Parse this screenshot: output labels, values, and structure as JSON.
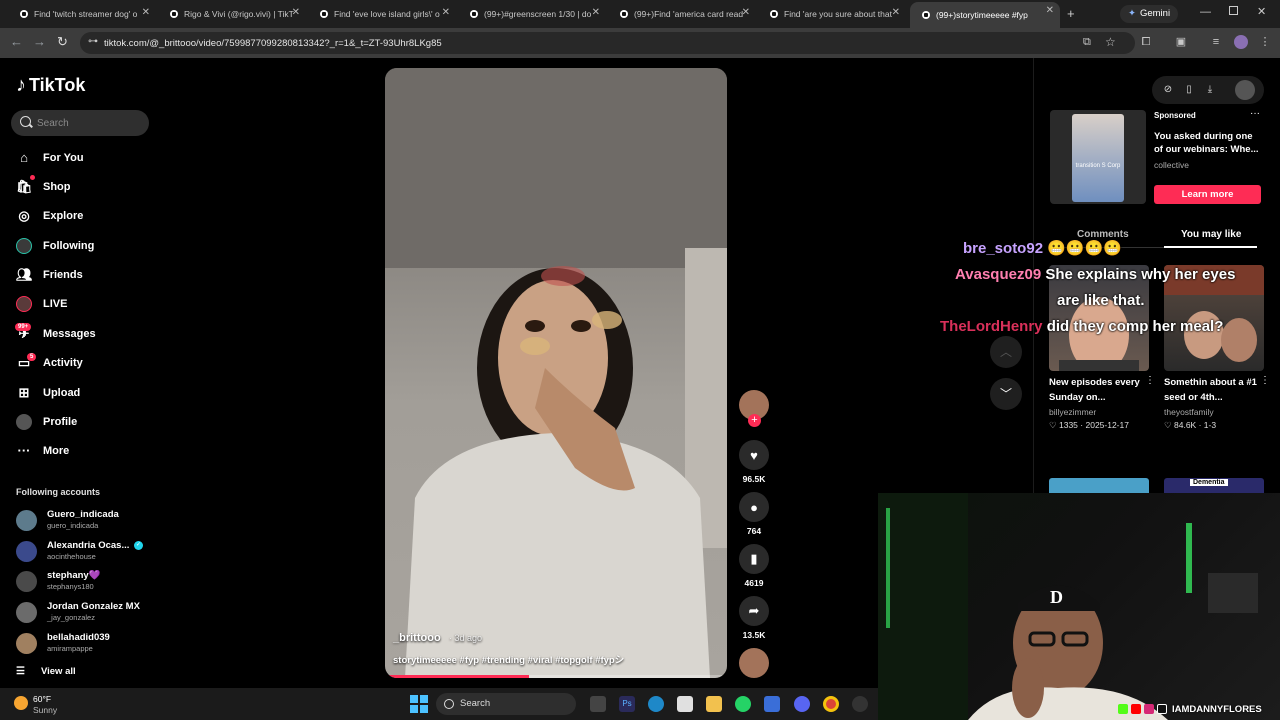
{
  "browser": {
    "tabs": [
      {
        "label": "Find 'twitch streamer dog' o"
      },
      {
        "label": "Rigo & Vivi (@rigo.vivi) | TikT"
      },
      {
        "label": "Find 'eve love island girls\\' o"
      },
      {
        "label": "(99+)#greenscreen 1/30 | do"
      },
      {
        "label": "(99+)Find 'america card read"
      },
      {
        "label": "Find 'are you sure about that"
      },
      {
        "label": "(99+)storytimeeeee #fyp"
      }
    ],
    "new_tab": "+",
    "gemini_label": "Gemini",
    "url": "tiktok.com/@_brittooo/video/7599877099280813342?_r=1&_t=ZT-93Uhr8LKg85"
  },
  "sidebar": {
    "logo": "TikTok",
    "search_placeholder": "Search",
    "items": [
      {
        "label": "For You",
        "icon": "home-icon"
      },
      {
        "label": "Shop",
        "icon": "shop-icon"
      },
      {
        "label": "Explore",
        "icon": "compass-icon"
      },
      {
        "label": "Following",
        "icon": "following-avatar-icon"
      },
      {
        "label": "Friends",
        "icon": "friends-icon"
      },
      {
        "label": "LIVE",
        "icon": "live-icon"
      },
      {
        "label": "Messages",
        "icon": "messages-icon",
        "badge": "99+"
      },
      {
        "label": "Activity",
        "icon": "activity-icon",
        "badge": "5"
      },
      {
        "label": "Upload",
        "icon": "upload-icon"
      },
      {
        "label": "Profile",
        "icon": "profile-icon"
      },
      {
        "label": "More",
        "icon": "more-icon"
      }
    ],
    "following_title": "Following accounts",
    "accounts": [
      {
        "name": "Guero_indicada",
        "handle": "guero_indicada"
      },
      {
        "name": "Alexandria Ocas...",
        "handle": "aocinthehouse"
      },
      {
        "name": "stephany💜",
        "handle": "stephanys180"
      },
      {
        "name": "Jordan Gonzalez MX",
        "handle": "_jay_gonzalez"
      },
      {
        "name": "bellahadid039",
        "handle": "amirampappe"
      }
    ],
    "view_all": "View all"
  },
  "video": {
    "author": "_brittooo",
    "date": "· 3d ago",
    "caption": "storytimeeeee #fyp #trending #viral #topgolf #fypシ",
    "progress": 0.42
  },
  "actions": {
    "likes": "96.5K",
    "comments": "764",
    "saves": "4619",
    "shares": "13.5K"
  },
  "right_panel": {
    "sponsored": "Sponsored",
    "ad_title": "You asked during one of our webinars: Whe...",
    "ad_brand": "collective",
    "ad_thumb_text": "transition S Corp",
    "learn_more": "Learn more",
    "tab_comments": "Comments",
    "tab_you_may_like": "You may like",
    "recommended": [
      {
        "title": "New episodes every Sunday on...",
        "author": "billyezimmer",
        "likes": "1335",
        "date": "2025-12-17"
      },
      {
        "title": "Somethin about a #1 seed or 4th...",
        "author": "theyostfamily",
        "likes": "84.6K",
        "date": "1-3"
      }
    ],
    "dementia_label": "Dementia"
  },
  "chat_overlay": [
    {
      "user": "bre_soto92",
      "msg": "😬😬😬😬",
      "color": "#c7a3ff"
    },
    {
      "user": "Avasquez09",
      "msg": "She explains why her eyes",
      "color": "#ff7fb0"
    },
    {
      "user": "",
      "msg": "are like that.",
      "color": "#ffffff"
    },
    {
      "user": "TheLordHenry",
      "msg": "did they comp her meal?",
      "color": "#d9305a"
    }
  ],
  "taskbar": {
    "temp": "60°F",
    "condition": "Sunny",
    "search_label": "Search"
  },
  "stream": {
    "handle": "IAMDANNYFLORES"
  },
  "colors": {
    "accent": "#fe2c55",
    "bg": "#000000"
  }
}
